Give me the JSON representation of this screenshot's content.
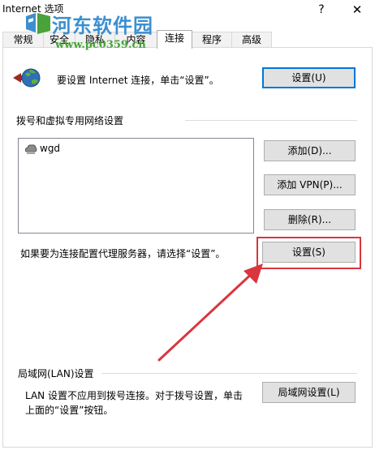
{
  "window": {
    "title": "Internet 选项",
    "help_glyph": "?",
    "close_glyph": "✕"
  },
  "watermark": {
    "title": "河东软件园",
    "url": "www.pc0359.cn"
  },
  "tabs": [
    {
      "label": "常规"
    },
    {
      "label": "安全"
    },
    {
      "label": "隐私"
    },
    {
      "label": "内容"
    },
    {
      "label": "连接",
      "active": true
    },
    {
      "label": "程序"
    },
    {
      "label": "高级"
    }
  ],
  "setup": {
    "text": "要设置 Internet 连接，单击“设置”。",
    "button": "设置(U)"
  },
  "dialup": {
    "heading": "拨号和虚拟专用网络设置",
    "items": [
      {
        "label": "wgd"
      }
    ],
    "add_button": "添加(D)...",
    "add_vpn_button": "添加 VPN(P)...",
    "delete_button": "删除(R)...",
    "proxy_text": "如果要为连接配置代理服务器，请选择“设置”。",
    "settings_button": "设置(S)"
  },
  "lan": {
    "heading": "局域网(LAN)设置",
    "text_line1": "LAN 设置不应用到拨号连接。对于拨号设置，单击",
    "text_line2": "上面的“设置”按钮。",
    "button": "局域网设置(L)"
  },
  "colors": {
    "annotation_red": "#d9363e",
    "watermark_blue": "#3b8fd0",
    "watermark_green": "#49a33a"
  }
}
